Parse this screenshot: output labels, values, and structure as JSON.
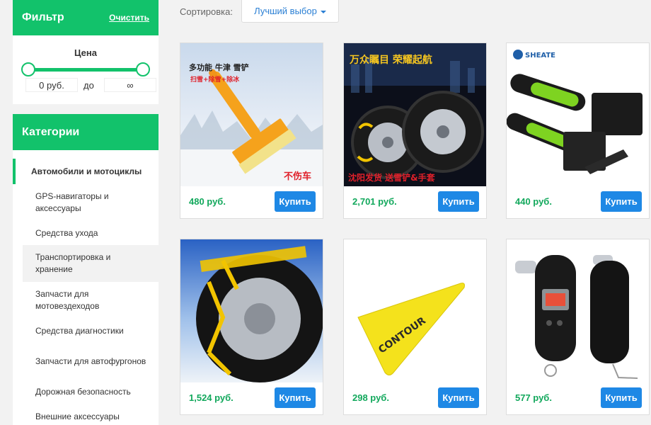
{
  "filter": {
    "title": "Фильтр",
    "clear_label": "Очистить",
    "price_label": "Цена",
    "price_from": "0 руб.",
    "price_to_label": "до",
    "price_to": "∞"
  },
  "categories": {
    "title": "Категории",
    "items": [
      {
        "label": "Автомобили и мотоциклы"
      },
      {
        "label": "GPS-навигаторы и аксессуары"
      },
      {
        "label": "Средства ухода"
      },
      {
        "label": "Транспортировка и хранение"
      },
      {
        "label": "Запчасти для мотовездеходов"
      },
      {
        "label": "Средства диагностики"
      },
      {
        "label": "Запчасти для автофургонов"
      },
      {
        "label": "Дорожная безопасность"
      },
      {
        "label": "Внешние аксессуары"
      }
    ]
  },
  "sort": {
    "label": "Сортировка:",
    "selected": "Лучший выбор"
  },
  "products": [
    {
      "price": "480 руб.",
      "buy_label": "Купить",
      "img_text_1": "多功能 牛津 雪铲",
      "img_text_2": "扫雪+除雪+除冰",
      "img_text_3": "不伤车"
    },
    {
      "price": "2,701 руб.",
      "buy_label": "Купить",
      "img_text_1": "万众瞩目 荣耀起航",
      "img_text_2": "沈阳发货  送雪铲&手套"
    },
    {
      "price": "440 руб.",
      "buy_label": "Купить",
      "img_text_1": "SHEATE"
    },
    {
      "price": "1,524 руб.",
      "buy_label": "Купить"
    },
    {
      "price": "298 руб.",
      "buy_label": "Купить",
      "img_text_1": "CONTOUR"
    },
    {
      "price": "577 руб.",
      "buy_label": "Купить"
    }
  ],
  "colors": {
    "accent": "#12c26b",
    "price": "#12a85c",
    "button": "#1e88e5",
    "link": "#2a7fd4"
  }
}
